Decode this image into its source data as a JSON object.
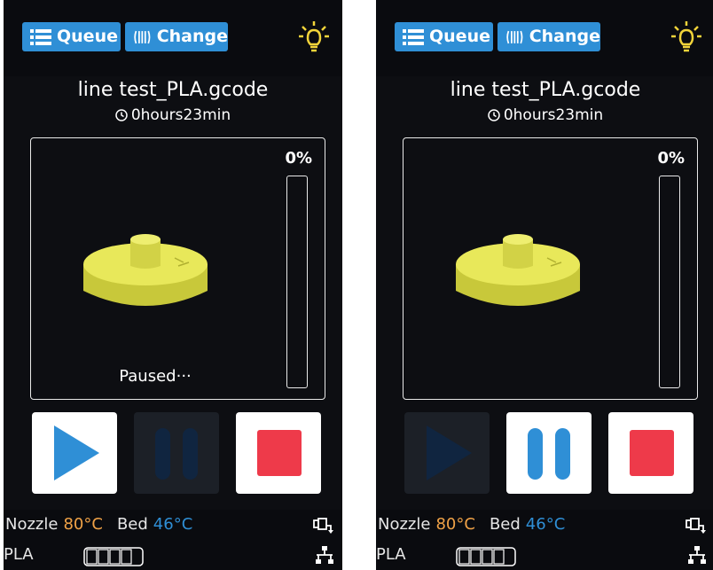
{
  "screens": [
    {
      "header": {
        "queue_label": "Queue",
        "change_label": "Change",
        "light_icon": "lightbulb-icon"
      },
      "file": {
        "name": "line test_PLA.gcode",
        "time": "0hours23min"
      },
      "progress": {
        "percent_label": "0%",
        "value": 0
      },
      "status": "Paused···",
      "controls": {
        "play_enabled": true,
        "pause_enabled": false,
        "stop_enabled": true
      },
      "footer": {
        "nozzle_label": "Nozzle",
        "nozzle_temp": "80°C",
        "bed_label": "Bed",
        "bed_temp": "46°C",
        "material": "PLA"
      }
    },
    {
      "header": {
        "queue_label": "Queue",
        "change_label": "Change",
        "light_icon": "lightbulb-icon"
      },
      "file": {
        "name": "line test_PLA.gcode",
        "time": "0hours23min"
      },
      "progress": {
        "percent_label": "0%",
        "value": 0
      },
      "status": "",
      "controls": {
        "play_enabled": false,
        "pause_enabled": true,
        "stop_enabled": true
      },
      "footer": {
        "nozzle_label": "Nozzle",
        "nozzle_temp": "80°C",
        "bed_label": "Bed",
        "bed_temp": "46°C",
        "material": "PLA"
      }
    }
  ],
  "colors": {
    "accent_blue": "#2f8fd6",
    "stop_red": "#ee3a4a",
    "nozzle_orange": "#f0a247",
    "model_yellow": "#e8e85a",
    "disabled_button": "#1c2027",
    "bulb_yellow": "#f2d43a"
  }
}
